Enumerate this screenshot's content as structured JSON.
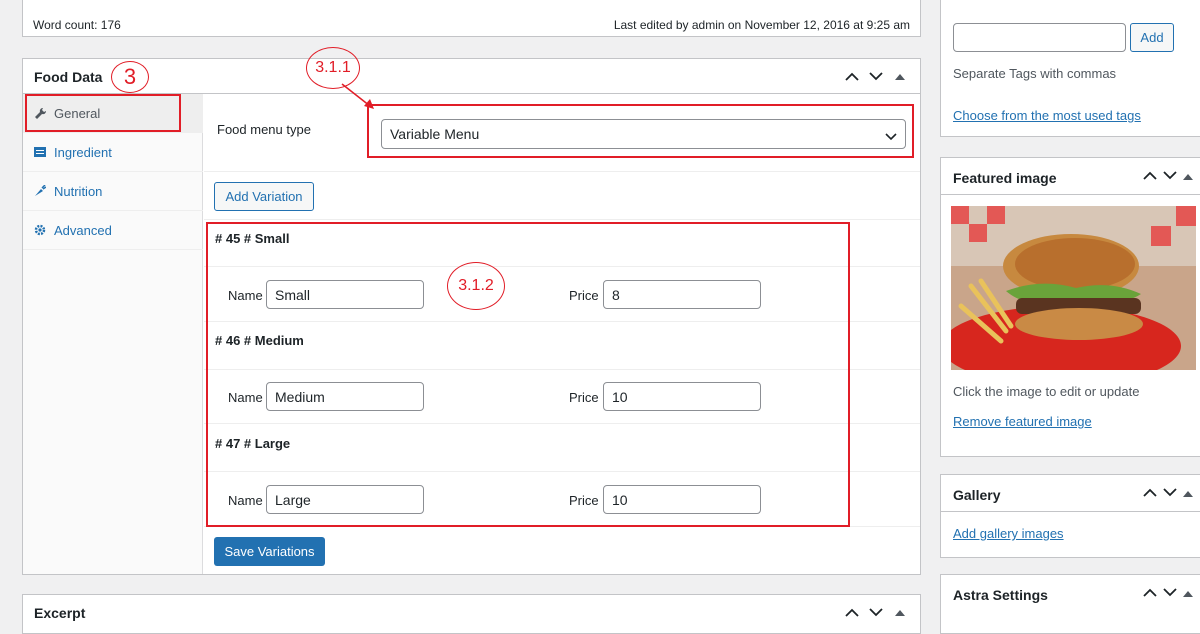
{
  "editor_status": {
    "word_count": "Word count: 176",
    "last_edited": "Last edited by admin on November 12, 2016 at 9:25 am"
  },
  "food_data": {
    "title": "Food Data",
    "tabs": [
      {
        "label": "General",
        "icon": "wrench-icon",
        "active": true
      },
      {
        "label": "Ingredient",
        "icon": "list-icon",
        "active": false
      },
      {
        "label": "Nutrition",
        "icon": "carrot-icon",
        "active": false
      },
      {
        "label": "Advanced",
        "icon": "gear-icon",
        "active": false
      }
    ],
    "menu_type_label": "Food menu type",
    "menu_type_value": "Variable Menu",
    "add_variation_label": "Add Variation",
    "variations": [
      {
        "title": "# 45 # Small",
        "name_label": "Name",
        "name": "Small",
        "price_label": "Price",
        "price": "8"
      },
      {
        "title": "# 46 # Medium",
        "name_label": "Name",
        "name": "Medium",
        "price_label": "Price",
        "price": "10"
      },
      {
        "title": "# 47 # Large",
        "name_label": "Name",
        "name": "Large",
        "price_label": "Price",
        "price": "10"
      }
    ],
    "save_variations_label": "Save Variations"
  },
  "annotations": {
    "step_3": "3",
    "step_3_1_1": "3.1.1",
    "step_3_1_2": "3.1.2",
    "color": "#e11d27"
  },
  "tags": {
    "add_label": "Add",
    "separate_hint": "Separate Tags with commas",
    "most_used_link": "Choose from the most used tags"
  },
  "featured_image": {
    "title": "Featured image",
    "hint": "Click the image to edit or update",
    "remove_link": "Remove featured image"
  },
  "gallery": {
    "title": "Gallery",
    "add_link": "Add gallery images"
  },
  "astra": {
    "title": "Astra Settings"
  },
  "excerpt": {
    "title": "Excerpt"
  },
  "colors": {
    "primary": "#2271b1",
    "annotation": "#e11d27"
  }
}
